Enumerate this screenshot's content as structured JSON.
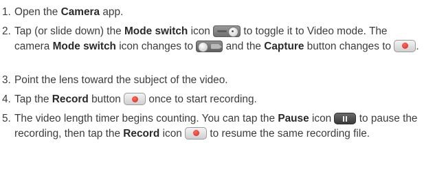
{
  "steps": [
    {
      "number": "1.",
      "pre": "Open the ",
      "bold": "Camera",
      "post": " app."
    },
    {
      "number": "2.",
      "t1": "Tap (or slide down) the ",
      "b1": "Mode switch",
      "t2": " icon ",
      "t3": " to toggle it to Video mode. The camera ",
      "b2": "Mode switch",
      "t4": " icon changes to ",
      "t5": " and the ",
      "b3": "Capture",
      "t6": " button changes to ",
      "t7": "."
    },
    {
      "number": "3.",
      "text": "Point the lens toward the subject of the video."
    },
    {
      "number": "4.",
      "t1": "Tap the ",
      "b1": "Record",
      "t2": " button ",
      "t3": " once to start recording."
    },
    {
      "number": "5.",
      "t1": "The video length timer begins counting. You can tap the ",
      "b1": "Pause",
      "t2": " icon ",
      "t3": " to pause the recording, then tap the ",
      "b2": "Record",
      "t4": " icon ",
      "t5": " to resume the same recording file."
    }
  ],
  "icons": {
    "mode_switch": "mode-switch-icon",
    "mode_switch_video": "video-mode-switch-icon",
    "record": "record-icon",
    "pause": "pause-icon",
    "record_color": "#d2281c"
  }
}
